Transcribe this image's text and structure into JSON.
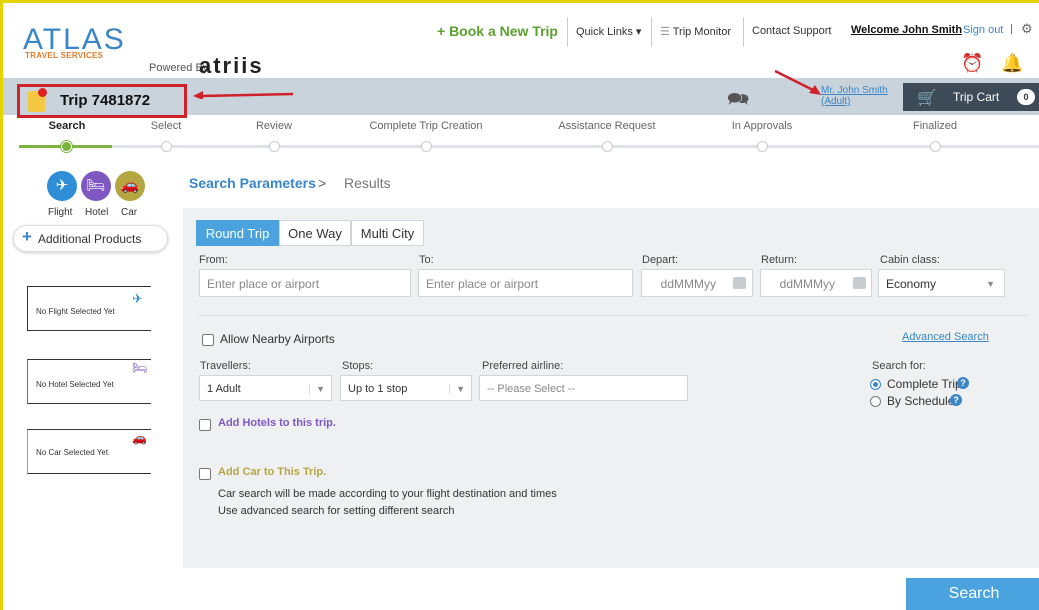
{
  "header": {
    "logo_text": "ATLAS",
    "logo_subtext": "TRAVEL SERVICES",
    "powered_by": "Powered By",
    "brand": "atriis",
    "book_new": "+ Book a New Trip",
    "quick_links": "Quick Links ▾",
    "trip_monitor": "Trip Monitor",
    "contact_support": "Contact Support",
    "welcome": "Welcome John Smith",
    "sign_out": "Sign out",
    "separator": "|"
  },
  "tripbar": {
    "title": "Trip 7481872",
    "traveller": "Mr. John Smith (Adult)",
    "cart_label": "Trip Cart",
    "cart_count": "0"
  },
  "steps": [
    {
      "label": "Search",
      "active": true
    },
    {
      "label": "Select"
    },
    {
      "label": "Review"
    },
    {
      "label": "Complete Trip Creation"
    },
    {
      "label": "Assistance Request"
    },
    {
      "label": "In Approvals"
    },
    {
      "label": "Finalized"
    }
  ],
  "modes": {
    "flight": "Flight",
    "hotel": "Hotel",
    "car": "Car"
  },
  "additional_products": "Additional Products",
  "slots": {
    "flight": "No Flight Selected Yet",
    "hotel": "No Hotel Selected Yet",
    "car": "No Car Selected Yet"
  },
  "breadcrumb": {
    "params": "Search Parameters",
    "sep": ">",
    "results": "Results"
  },
  "tabs": {
    "round_trip": "Round Trip",
    "one_way": "One Way",
    "multi_city": "Multi City"
  },
  "form": {
    "from_label": "From:",
    "from_placeholder": "Enter place or airport",
    "to_label": "To:",
    "to_placeholder": "Enter place or airport",
    "depart_label": "Depart:",
    "depart_placeholder": "ddMMMyy",
    "return_label": "Return:",
    "return_placeholder": "ddMMMyy",
    "cabin_label": "Cabin class:",
    "cabin_value": "Economy",
    "nearby": "Allow Nearby Airports",
    "advanced": "Advanced Search",
    "travellers_label": "Travellers:",
    "travellers_value": "1 Adult",
    "stops_label": "Stops:",
    "stops_value": "Up to 1 stop",
    "airline_label": "Preferred airline:",
    "airline_value": "-- Please Select --",
    "search_for_label": "Search for:",
    "complete_trip": "Complete Trip",
    "by_schedule": "By Schedule",
    "add_hotels": "Add Hotels to this trip.",
    "add_car": "Add Car to This Trip.",
    "car_note_1": "Car search will be made according to your flight destination and times",
    "car_note_2": "Use advanced search for setting different search"
  },
  "search_button": "Search",
  "colors": {
    "accent": "#4aa3df",
    "progress": "#7ab43c",
    "annotation": "#d0202a",
    "hotel": "#7e57c2",
    "car": "#b5a642"
  }
}
